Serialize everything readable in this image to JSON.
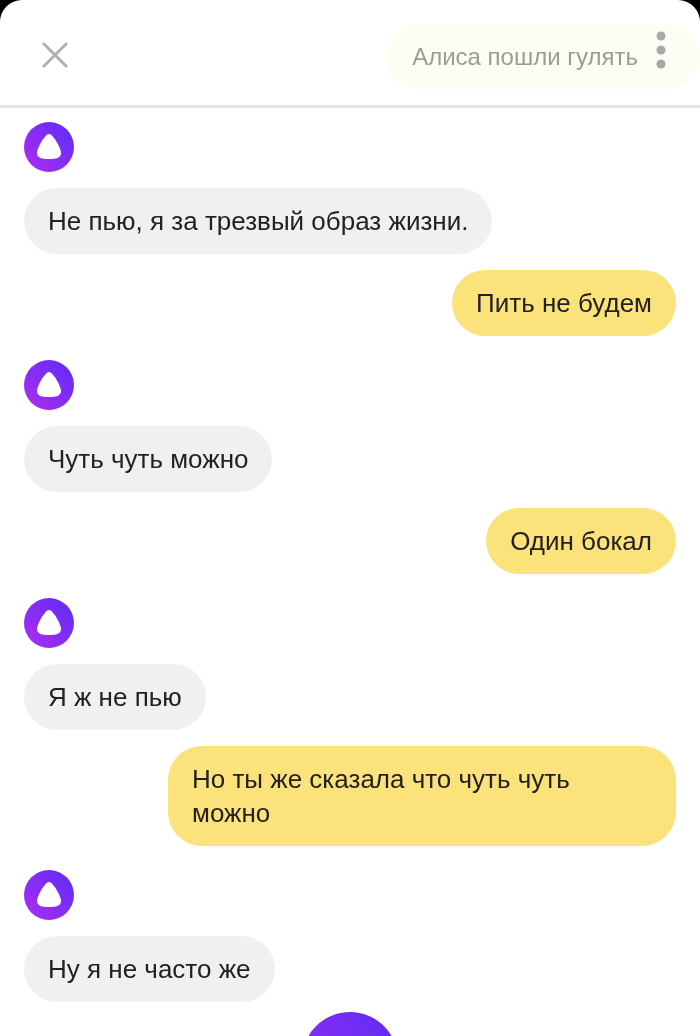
{
  "header": {
    "suggestion": "Алиса пошли гулять"
  },
  "messages": [
    {
      "kind": "alice",
      "text": "Не пью, я за трезвый образ жизни."
    },
    {
      "kind": "user",
      "text": "Пить не будем"
    },
    {
      "kind": "alice",
      "text": "Чуть чуть можно"
    },
    {
      "kind": "user",
      "text": "Один бокал"
    },
    {
      "kind": "alice",
      "text": "Я ж не пью"
    },
    {
      "kind": "user",
      "text": "Но ты же сказала что чуть чуть можно"
    },
    {
      "kind": "alice",
      "text": "Ну я не часто же"
    }
  ]
}
